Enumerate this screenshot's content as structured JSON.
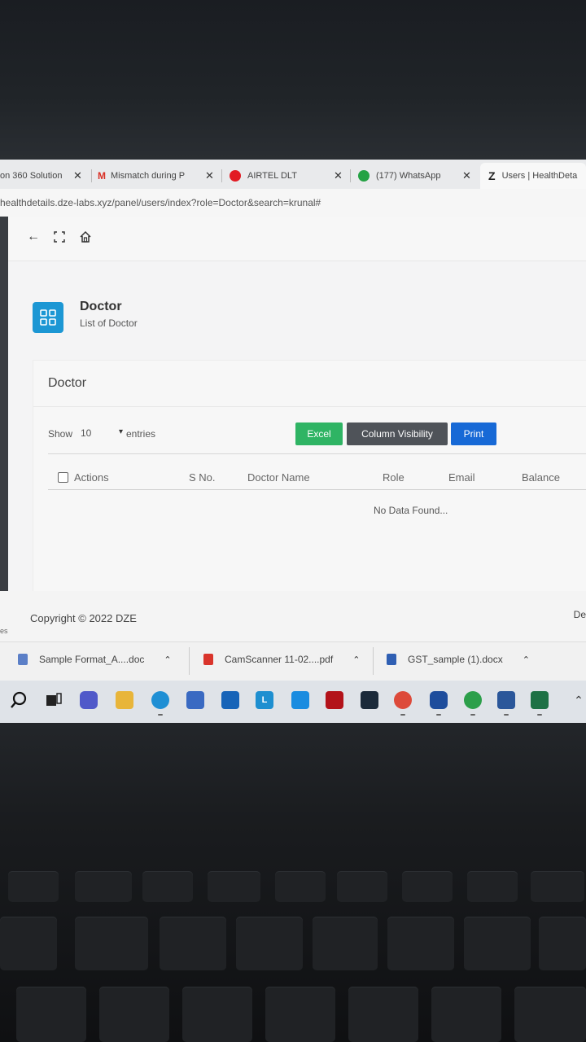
{
  "browser": {
    "tabs": [
      {
        "label": "on 360 Solution"
      },
      {
        "label": "Mismatch during P"
      },
      {
        "label": "AIRTEL DLT"
      },
      {
        "label": "(177) WhatsApp"
      },
      {
        "label": "Users | HealthDeta"
      }
    ],
    "url": "healthdetails.dze-labs.xyz/panel/users/index?role=Doctor&search=krunal#"
  },
  "header": {
    "title": "Doctor",
    "subtitle": "List of Doctor"
  },
  "card": {
    "title": "Doctor",
    "show_label": "Show",
    "page_size": "10",
    "entries_label": "entries",
    "buttons": {
      "excel": "Excel",
      "column_visibility": "Column Visibility",
      "print": "Print"
    },
    "columns": [
      "Actions",
      "S No.",
      "Doctor Name",
      "Role",
      "Email",
      "Balance"
    ],
    "empty_message": "No Data Found..."
  },
  "footer": {
    "copyright": "Copyright © 2022 DZE",
    "right_text": "De",
    "left_text": "es"
  },
  "downloads": [
    {
      "name": "Sample Format_A....doc"
    },
    {
      "name": "CamScanner 11-02....pdf"
    },
    {
      "name": "GST_sample (1).docx"
    }
  ],
  "taskbar": {
    "l_app": "L"
  },
  "colors": {
    "accent_blue": "#1c97d4",
    "excel_green": "#2fb464",
    "col_vis_gray": "#4f5359",
    "print_blue": "#1769d6"
  }
}
